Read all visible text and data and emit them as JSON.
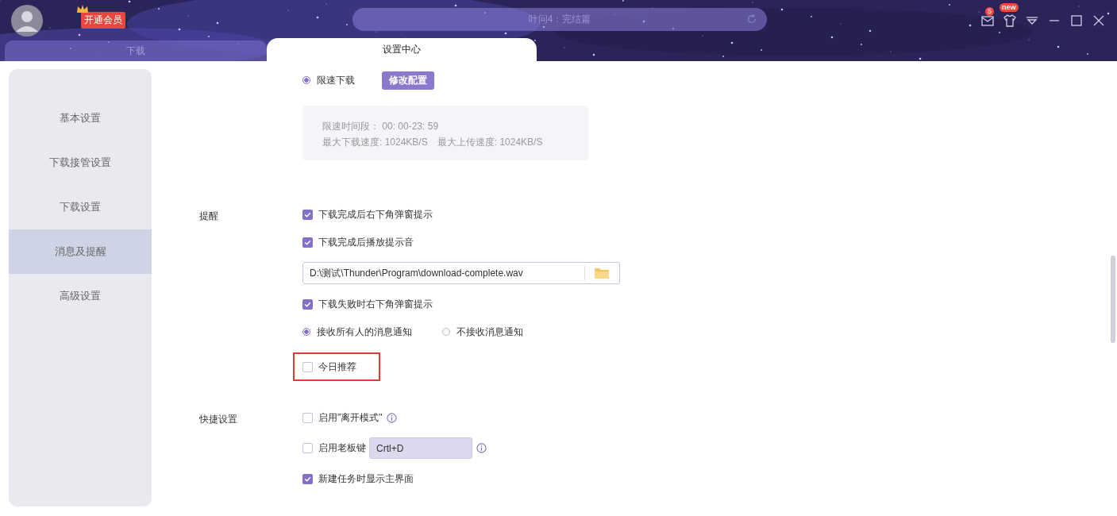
{
  "header": {
    "vip_badge": "开通会员",
    "search": {
      "placeholder": "叶问4：完结篇"
    },
    "mail_badge": "5",
    "skin_badge": "new"
  },
  "tabs": [
    {
      "label": "下载",
      "selected": false
    },
    {
      "label": "设置中心",
      "selected": true
    }
  ],
  "sidebar": {
    "items": [
      {
        "label": "基本设置",
        "selected": false
      },
      {
        "label": "下载接管设置",
        "selected": false
      },
      {
        "label": "下载设置",
        "selected": false
      },
      {
        "label": "消息及提醒",
        "selected": true
      },
      {
        "label": "高级设置",
        "selected": false
      }
    ]
  },
  "speed_limit": {
    "label": "限速下载",
    "selected": true,
    "button": "修改配置",
    "info": [
      "限速时间段： 00: 00-23: 59",
      "最大下载速度: 1024KB/S",
      "最大上传速度: 1024KB/S"
    ]
  },
  "sections": [
    {
      "label": "提醒",
      "rows": [
        {
          "kind": "checkbox",
          "label": "下载完成后右下角弹窗提示",
          "checked": true
        },
        {
          "kind": "checkbox",
          "label": "下载完成后播放提示音",
          "checked": true
        },
        {
          "kind": "file",
          "value": "D:\\测试\\Thunder\\Program\\download-complete.wav"
        },
        {
          "kind": "checkbox",
          "label": "下载失败时右下角弹窗提示",
          "checked": true
        },
        {
          "kind": "radios",
          "options": [
            {
              "label": "接收所有人的消息通知",
              "selected": true
            },
            {
              "label": "不接收消息通知",
              "selected": false
            }
          ]
        },
        {
          "kind": "checkbox",
          "label": "今日推荐",
          "checked": false,
          "highlighted": true
        }
      ]
    },
    {
      "label": "快捷设置",
      "rows": [
        {
          "kind": "checkbox",
          "label": "启用\"离开模式\"",
          "checked": false,
          "info": true
        },
        {
          "kind": "checkbox",
          "label": "启用老板键",
          "checked": false,
          "shortcut": "Crtl+D",
          "info": true
        },
        {
          "kind": "checkbox",
          "label": "新建任务时显示主界面",
          "checked": true
        }
      ]
    }
  ]
}
